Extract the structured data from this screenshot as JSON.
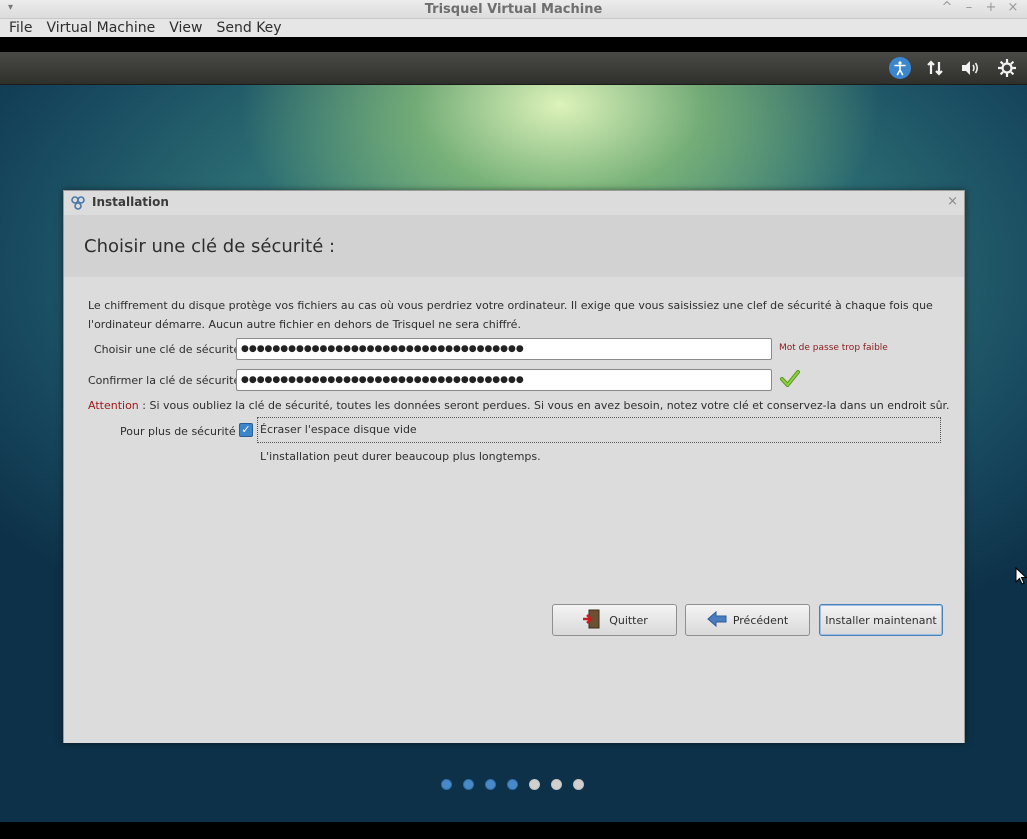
{
  "host": {
    "title": "Trisquel Virtual Machine",
    "menu": [
      "File",
      "Virtual Machine",
      "View",
      "Send Key"
    ],
    "controls": [
      "^",
      "–",
      "+",
      "×"
    ]
  },
  "panel": {
    "icons": [
      "accessibility-icon",
      "network-icon",
      "volume-icon",
      "settings-icon"
    ]
  },
  "dialog": {
    "title": "Installation",
    "close": "×",
    "heading": "Choisir une clé de sécurité :",
    "description": "Le chiffrement du disque protège vos fichiers au cas où vous perdriez votre ordinateur. Il exige que vous saisissiez une clef de sécurité à chaque fois que l'ordinateur démarre. Aucun autre fichier en dehors de Trisquel ne sera chiffré.",
    "key_label": "Choisir une clé de sécurité :",
    "key_value": "●●●●●●●●●●●●●●●●●●●●●●●●●●●●●●●●●●●●",
    "strength": "Mot de passe trop faible",
    "confirm_label": "Confirmer la clé de sécurité :",
    "confirm_value": "●●●●●●●●●●●●●●●●●●●●●●●●●●●●●●●●●●●●",
    "attention_label": "Attention",
    "attention_text": " : Si vous oubliez la clé de sécurité, toutes les données seront perdues. Si vous en avez besoin, notez votre clé et conservez-la dans un endroit sûr.",
    "security_label": "Pour plus de sécurité :",
    "overwrite_label": "Écraser l'espace disque vide",
    "overwrite_checked": true,
    "overwrite_hint": "L'installation peut durer beaucoup plus longtemps.",
    "buttons": {
      "quit": "Quitter",
      "back": "Précédent",
      "install": "Installer maintenant"
    },
    "progress": {
      "total_steps": 7,
      "completed_steps": 4
    }
  },
  "colors": {
    "accent": "#3d86cc",
    "warning": "#a01a1a"
  }
}
